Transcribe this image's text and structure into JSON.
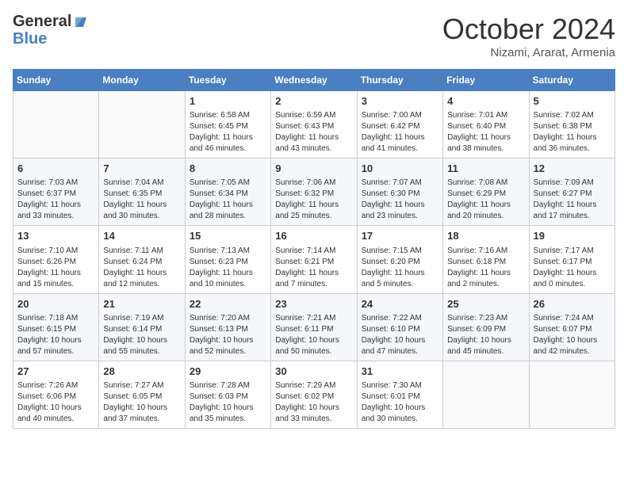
{
  "header": {
    "logo_line1": "General",
    "logo_line2": "Blue",
    "month": "October 2024",
    "location": "Nizami, Ararat, Armenia"
  },
  "weekdays": [
    "Sunday",
    "Monday",
    "Tuesday",
    "Wednesday",
    "Thursday",
    "Friday",
    "Saturday"
  ],
  "weeks": [
    [
      {
        "day": "",
        "sunrise": "",
        "sunset": "",
        "daylight": ""
      },
      {
        "day": "",
        "sunrise": "",
        "sunset": "",
        "daylight": ""
      },
      {
        "day": "1",
        "sunrise": "Sunrise: 6:58 AM",
        "sunset": "Sunset: 6:45 PM",
        "daylight": "Daylight: 11 hours and 46 minutes."
      },
      {
        "day": "2",
        "sunrise": "Sunrise: 6:59 AM",
        "sunset": "Sunset: 6:43 PM",
        "daylight": "Daylight: 11 hours and 43 minutes."
      },
      {
        "day": "3",
        "sunrise": "Sunrise: 7:00 AM",
        "sunset": "Sunset: 6:42 PM",
        "daylight": "Daylight: 11 hours and 41 minutes."
      },
      {
        "day": "4",
        "sunrise": "Sunrise: 7:01 AM",
        "sunset": "Sunset: 6:40 PM",
        "daylight": "Daylight: 11 hours and 38 minutes."
      },
      {
        "day": "5",
        "sunrise": "Sunrise: 7:02 AM",
        "sunset": "Sunset: 6:38 PM",
        "daylight": "Daylight: 11 hours and 36 minutes."
      }
    ],
    [
      {
        "day": "6",
        "sunrise": "Sunrise: 7:03 AM",
        "sunset": "Sunset: 6:37 PM",
        "daylight": "Daylight: 11 hours and 33 minutes."
      },
      {
        "day": "7",
        "sunrise": "Sunrise: 7:04 AM",
        "sunset": "Sunset: 6:35 PM",
        "daylight": "Daylight: 11 hours and 30 minutes."
      },
      {
        "day": "8",
        "sunrise": "Sunrise: 7:05 AM",
        "sunset": "Sunset: 6:34 PM",
        "daylight": "Daylight: 11 hours and 28 minutes."
      },
      {
        "day": "9",
        "sunrise": "Sunrise: 7:06 AM",
        "sunset": "Sunset: 6:32 PM",
        "daylight": "Daylight: 11 hours and 25 minutes."
      },
      {
        "day": "10",
        "sunrise": "Sunrise: 7:07 AM",
        "sunset": "Sunset: 6:30 PM",
        "daylight": "Daylight: 11 hours and 23 minutes."
      },
      {
        "day": "11",
        "sunrise": "Sunrise: 7:08 AM",
        "sunset": "Sunset: 6:29 PM",
        "daylight": "Daylight: 11 hours and 20 minutes."
      },
      {
        "day": "12",
        "sunrise": "Sunrise: 7:09 AM",
        "sunset": "Sunset: 6:27 PM",
        "daylight": "Daylight: 11 hours and 17 minutes."
      }
    ],
    [
      {
        "day": "13",
        "sunrise": "Sunrise: 7:10 AM",
        "sunset": "Sunset: 6:26 PM",
        "daylight": "Daylight: 11 hours and 15 minutes."
      },
      {
        "day": "14",
        "sunrise": "Sunrise: 7:11 AM",
        "sunset": "Sunset: 6:24 PM",
        "daylight": "Daylight: 11 hours and 12 minutes."
      },
      {
        "day": "15",
        "sunrise": "Sunrise: 7:13 AM",
        "sunset": "Sunset: 6:23 PM",
        "daylight": "Daylight: 11 hours and 10 minutes."
      },
      {
        "day": "16",
        "sunrise": "Sunrise: 7:14 AM",
        "sunset": "Sunset: 6:21 PM",
        "daylight": "Daylight: 11 hours and 7 minutes."
      },
      {
        "day": "17",
        "sunrise": "Sunrise: 7:15 AM",
        "sunset": "Sunset: 6:20 PM",
        "daylight": "Daylight: 11 hours and 5 minutes."
      },
      {
        "day": "18",
        "sunrise": "Sunrise: 7:16 AM",
        "sunset": "Sunset: 6:18 PM",
        "daylight": "Daylight: 11 hours and 2 minutes."
      },
      {
        "day": "19",
        "sunrise": "Sunrise: 7:17 AM",
        "sunset": "Sunset: 6:17 PM",
        "daylight": "Daylight: 11 hours and 0 minutes."
      }
    ],
    [
      {
        "day": "20",
        "sunrise": "Sunrise: 7:18 AM",
        "sunset": "Sunset: 6:15 PM",
        "daylight": "Daylight: 10 hours and 57 minutes."
      },
      {
        "day": "21",
        "sunrise": "Sunrise: 7:19 AM",
        "sunset": "Sunset: 6:14 PM",
        "daylight": "Daylight: 10 hours and 55 minutes."
      },
      {
        "day": "22",
        "sunrise": "Sunrise: 7:20 AM",
        "sunset": "Sunset: 6:13 PM",
        "daylight": "Daylight: 10 hours and 52 minutes."
      },
      {
        "day": "23",
        "sunrise": "Sunrise: 7:21 AM",
        "sunset": "Sunset: 6:11 PM",
        "daylight": "Daylight: 10 hours and 50 minutes."
      },
      {
        "day": "24",
        "sunrise": "Sunrise: 7:22 AM",
        "sunset": "Sunset: 6:10 PM",
        "daylight": "Daylight: 10 hours and 47 minutes."
      },
      {
        "day": "25",
        "sunrise": "Sunrise: 7:23 AM",
        "sunset": "Sunset: 6:09 PM",
        "daylight": "Daylight: 10 hours and 45 minutes."
      },
      {
        "day": "26",
        "sunrise": "Sunrise: 7:24 AM",
        "sunset": "Sunset: 6:07 PM",
        "daylight": "Daylight: 10 hours and 42 minutes."
      }
    ],
    [
      {
        "day": "27",
        "sunrise": "Sunrise: 7:26 AM",
        "sunset": "Sunset: 6:06 PM",
        "daylight": "Daylight: 10 hours and 40 minutes."
      },
      {
        "day": "28",
        "sunrise": "Sunrise: 7:27 AM",
        "sunset": "Sunset: 6:05 PM",
        "daylight": "Daylight: 10 hours and 37 minutes."
      },
      {
        "day": "29",
        "sunrise": "Sunrise: 7:28 AM",
        "sunset": "Sunset: 6:03 PM",
        "daylight": "Daylight: 10 hours and 35 minutes."
      },
      {
        "day": "30",
        "sunrise": "Sunrise: 7:29 AM",
        "sunset": "Sunset: 6:02 PM",
        "daylight": "Daylight: 10 hours and 33 minutes."
      },
      {
        "day": "31",
        "sunrise": "Sunrise: 7:30 AM",
        "sunset": "Sunset: 6:01 PM",
        "daylight": "Daylight: 10 hours and 30 minutes."
      },
      {
        "day": "",
        "sunrise": "",
        "sunset": "",
        "daylight": ""
      },
      {
        "day": "",
        "sunrise": "",
        "sunset": "",
        "daylight": ""
      }
    ]
  ]
}
